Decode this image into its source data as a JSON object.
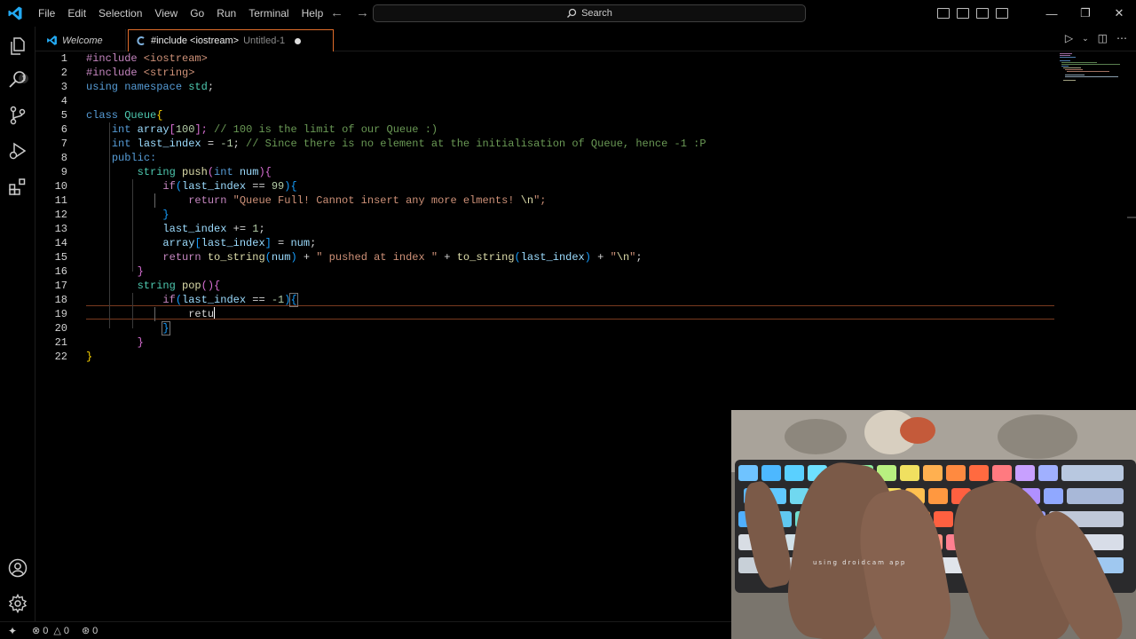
{
  "menu": [
    "File",
    "Edit",
    "Selection",
    "View",
    "Go",
    "Run",
    "Terminal",
    "Help"
  ],
  "search": {
    "label": "Search"
  },
  "tabs": [
    {
      "label": "Welcome"
    },
    {
      "label": "#include <iostream>",
      "sub": "Untitled-1"
    }
  ],
  "editor": {
    "lines": [
      {
        "n": "1"
      },
      {
        "n": "2"
      },
      {
        "n": "3"
      },
      {
        "n": "4"
      },
      {
        "n": "5"
      },
      {
        "n": "6"
      },
      {
        "n": "7"
      },
      {
        "n": "8"
      },
      {
        "n": "9"
      },
      {
        "n": "10"
      },
      {
        "n": "11"
      },
      {
        "n": "12"
      },
      {
        "n": "13"
      },
      {
        "n": "14"
      },
      {
        "n": "15"
      },
      {
        "n": "16"
      },
      {
        "n": "17"
      },
      {
        "n": "18"
      },
      {
        "n": "19"
      },
      {
        "n": "20"
      },
      {
        "n": "21"
      },
      {
        "n": "22"
      }
    ],
    "code": {
      "l1": [
        "#include",
        " <iostream>"
      ],
      "l2": [
        "#include",
        " <string>"
      ],
      "l3": [
        "using",
        " namespace",
        " std",
        ";"
      ],
      "l5": [
        "class",
        " Queue",
        "{"
      ],
      "l6": [
        "int",
        " array",
        "[",
        "100",
        "];",
        " // 100 is the limit of our Queue :)"
      ],
      "l7": [
        "int",
        " last_index",
        " = ",
        "-1",
        ";",
        " // Since there is no element at the initialisation of Queue, hence -1 :P"
      ],
      "l8": [
        "public:"
      ],
      "l9": [
        "string",
        " push",
        "(",
        "int",
        " num",
        ")",
        "{"
      ],
      "l10": [
        "if",
        "(",
        "last_index",
        " == ",
        "99",
        ")",
        "{"
      ],
      "l11": [
        "return",
        " \"Queue Full! Cannot insert any more elments! ",
        "\\n",
        "\";"
      ],
      "l12": [
        "}"
      ],
      "l13": [
        "last_index",
        " += ",
        "1",
        ";"
      ],
      "l14": [
        "array",
        "[",
        "last_index",
        "]",
        " = ",
        "num",
        ";"
      ],
      "l15": [
        "return",
        " to_string",
        "(",
        "num",
        ")",
        " + ",
        "\" pushed at index \"",
        " + ",
        "to_string",
        "(",
        "last_index",
        ")",
        " + ",
        "\"",
        "\\n",
        "\"",
        ";"
      ],
      "l16": [
        "}"
      ],
      "l17": [
        "string",
        " pop",
        "(",
        ")",
        "{"
      ],
      "l18": [
        "if",
        "(",
        "last_index",
        " == ",
        "-1",
        ")",
        "{"
      ],
      "l19": [
        "retu"
      ],
      "l20": [
        "}"
      ],
      "l21": [
        "}"
      ],
      "l22": [
        "}"
      ]
    }
  },
  "status": {
    "errors": "0",
    "warnings": "0",
    "ports": "0"
  },
  "webcam": {
    "watermark": "using droidcam app"
  },
  "colors": {
    "accent": "#e06c2a",
    "keyword": "#569cd6",
    "string": "#ce9178",
    "comment": "#6a9955"
  }
}
